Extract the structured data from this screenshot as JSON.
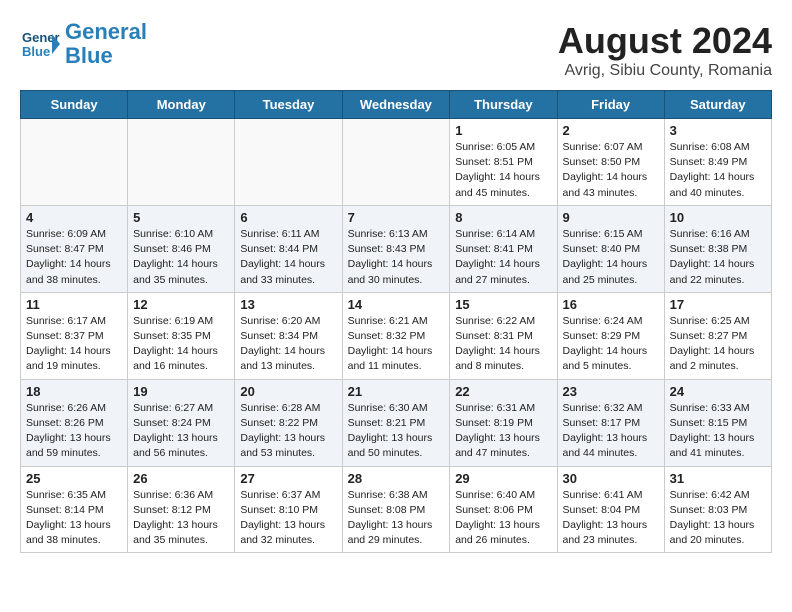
{
  "header": {
    "logo_line1": "General",
    "logo_line2": "Blue",
    "month_title": "August 2024",
    "subtitle": "Avrig, Sibiu County, Romania"
  },
  "weekdays": [
    "Sunday",
    "Monday",
    "Tuesday",
    "Wednesday",
    "Thursday",
    "Friday",
    "Saturday"
  ],
  "weeks": [
    [
      {
        "day": "",
        "info": ""
      },
      {
        "day": "",
        "info": ""
      },
      {
        "day": "",
        "info": ""
      },
      {
        "day": "",
        "info": ""
      },
      {
        "day": "1",
        "info": "Sunrise: 6:05 AM\nSunset: 8:51 PM\nDaylight: 14 hours\nand 45 minutes."
      },
      {
        "day": "2",
        "info": "Sunrise: 6:07 AM\nSunset: 8:50 PM\nDaylight: 14 hours\nand 43 minutes."
      },
      {
        "day": "3",
        "info": "Sunrise: 6:08 AM\nSunset: 8:49 PM\nDaylight: 14 hours\nand 40 minutes."
      }
    ],
    [
      {
        "day": "4",
        "info": "Sunrise: 6:09 AM\nSunset: 8:47 PM\nDaylight: 14 hours\nand 38 minutes."
      },
      {
        "day": "5",
        "info": "Sunrise: 6:10 AM\nSunset: 8:46 PM\nDaylight: 14 hours\nand 35 minutes."
      },
      {
        "day": "6",
        "info": "Sunrise: 6:11 AM\nSunset: 8:44 PM\nDaylight: 14 hours\nand 33 minutes."
      },
      {
        "day": "7",
        "info": "Sunrise: 6:13 AM\nSunset: 8:43 PM\nDaylight: 14 hours\nand 30 minutes."
      },
      {
        "day": "8",
        "info": "Sunrise: 6:14 AM\nSunset: 8:41 PM\nDaylight: 14 hours\nand 27 minutes."
      },
      {
        "day": "9",
        "info": "Sunrise: 6:15 AM\nSunset: 8:40 PM\nDaylight: 14 hours\nand 25 minutes."
      },
      {
        "day": "10",
        "info": "Sunrise: 6:16 AM\nSunset: 8:38 PM\nDaylight: 14 hours\nand 22 minutes."
      }
    ],
    [
      {
        "day": "11",
        "info": "Sunrise: 6:17 AM\nSunset: 8:37 PM\nDaylight: 14 hours\nand 19 minutes."
      },
      {
        "day": "12",
        "info": "Sunrise: 6:19 AM\nSunset: 8:35 PM\nDaylight: 14 hours\nand 16 minutes."
      },
      {
        "day": "13",
        "info": "Sunrise: 6:20 AM\nSunset: 8:34 PM\nDaylight: 14 hours\nand 13 minutes."
      },
      {
        "day": "14",
        "info": "Sunrise: 6:21 AM\nSunset: 8:32 PM\nDaylight: 14 hours\nand 11 minutes."
      },
      {
        "day": "15",
        "info": "Sunrise: 6:22 AM\nSunset: 8:31 PM\nDaylight: 14 hours\nand 8 minutes."
      },
      {
        "day": "16",
        "info": "Sunrise: 6:24 AM\nSunset: 8:29 PM\nDaylight: 14 hours\nand 5 minutes."
      },
      {
        "day": "17",
        "info": "Sunrise: 6:25 AM\nSunset: 8:27 PM\nDaylight: 14 hours\nand 2 minutes."
      }
    ],
    [
      {
        "day": "18",
        "info": "Sunrise: 6:26 AM\nSunset: 8:26 PM\nDaylight: 13 hours\nand 59 minutes."
      },
      {
        "day": "19",
        "info": "Sunrise: 6:27 AM\nSunset: 8:24 PM\nDaylight: 13 hours\nand 56 minutes."
      },
      {
        "day": "20",
        "info": "Sunrise: 6:28 AM\nSunset: 8:22 PM\nDaylight: 13 hours\nand 53 minutes."
      },
      {
        "day": "21",
        "info": "Sunrise: 6:30 AM\nSunset: 8:21 PM\nDaylight: 13 hours\nand 50 minutes."
      },
      {
        "day": "22",
        "info": "Sunrise: 6:31 AM\nSunset: 8:19 PM\nDaylight: 13 hours\nand 47 minutes."
      },
      {
        "day": "23",
        "info": "Sunrise: 6:32 AM\nSunset: 8:17 PM\nDaylight: 13 hours\nand 44 minutes."
      },
      {
        "day": "24",
        "info": "Sunrise: 6:33 AM\nSunset: 8:15 PM\nDaylight: 13 hours\nand 41 minutes."
      }
    ],
    [
      {
        "day": "25",
        "info": "Sunrise: 6:35 AM\nSunset: 8:14 PM\nDaylight: 13 hours\nand 38 minutes."
      },
      {
        "day": "26",
        "info": "Sunrise: 6:36 AM\nSunset: 8:12 PM\nDaylight: 13 hours\nand 35 minutes."
      },
      {
        "day": "27",
        "info": "Sunrise: 6:37 AM\nSunset: 8:10 PM\nDaylight: 13 hours\nand 32 minutes."
      },
      {
        "day": "28",
        "info": "Sunrise: 6:38 AM\nSunset: 8:08 PM\nDaylight: 13 hours\nand 29 minutes."
      },
      {
        "day": "29",
        "info": "Sunrise: 6:40 AM\nSunset: 8:06 PM\nDaylight: 13 hours\nand 26 minutes."
      },
      {
        "day": "30",
        "info": "Sunrise: 6:41 AM\nSunset: 8:04 PM\nDaylight: 13 hours\nand 23 minutes."
      },
      {
        "day": "31",
        "info": "Sunrise: 6:42 AM\nSunset: 8:03 PM\nDaylight: 13 hours\nand 20 minutes."
      }
    ]
  ]
}
